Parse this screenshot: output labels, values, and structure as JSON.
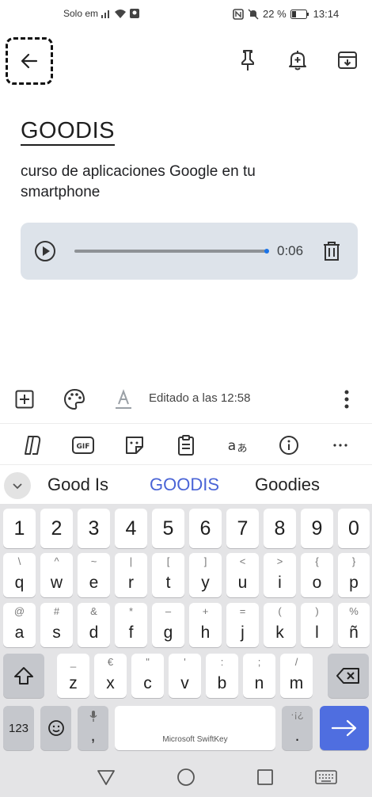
{
  "status_bar": {
    "carrier": "Solo em",
    "battery_percent": "22 %",
    "time": "13:14"
  },
  "note": {
    "title": "GOODIS",
    "body": "curso de aplicaciones Google en tu smartphone",
    "audio": {
      "duration": "0:06",
      "progress": 1.0
    }
  },
  "note_toolbar": {
    "edited_label": "Editado a las 12:58"
  },
  "suggestions": [
    "Good Is",
    "GOODIS",
    "Goodies"
  ],
  "keyboard": {
    "numbers": [
      "1",
      "2",
      "3",
      "4",
      "5",
      "6",
      "7",
      "8",
      "9",
      "0"
    ],
    "row1": [
      {
        "hint": "\\",
        "key": "q"
      },
      {
        "hint": "^",
        "key": "w"
      },
      {
        "hint": "~",
        "key": "e"
      },
      {
        "hint": "|",
        "key": "r"
      },
      {
        "hint": "[",
        "key": "t"
      },
      {
        "hint": "]",
        "key": "y"
      },
      {
        "hint": "<",
        "key": "u"
      },
      {
        "hint": ">",
        "key": "i"
      },
      {
        "hint": "{",
        "key": "o"
      },
      {
        "hint": "}",
        "key": "p"
      }
    ],
    "row2": [
      {
        "hint": "@",
        "key": "a"
      },
      {
        "hint": "#",
        "key": "s"
      },
      {
        "hint": "&",
        "key": "d"
      },
      {
        "hint": "*",
        "key": "f"
      },
      {
        "hint": "–",
        "key": "g"
      },
      {
        "hint": "+",
        "key": "h"
      },
      {
        "hint": "=",
        "key": "j"
      },
      {
        "hint": "(",
        "key": "k"
      },
      {
        "hint": ")",
        "key": "l"
      },
      {
        "hint": "%",
        "key": "ñ"
      }
    ],
    "row3": [
      {
        "hint": "_",
        "key": "z"
      },
      {
        "hint": "€",
        "key": "x"
      },
      {
        "hint": "\"",
        "key": "c"
      },
      {
        "hint": "'",
        "key": "v"
      },
      {
        "hint": ":",
        "key": "b"
      },
      {
        "hint": ";",
        "key": "n"
      },
      {
        "hint": "/",
        "key": "m"
      }
    ],
    "symbols_label": "123",
    "comma_label": ",",
    "period_label": ".",
    "period_hint": "·¡¿",
    "space_label": "Microsoft SwiftKey"
  },
  "colors": {
    "accent": "#4f6ee0",
    "audio_card": "#dde3ea",
    "progress_dot": "#1a73e8"
  }
}
